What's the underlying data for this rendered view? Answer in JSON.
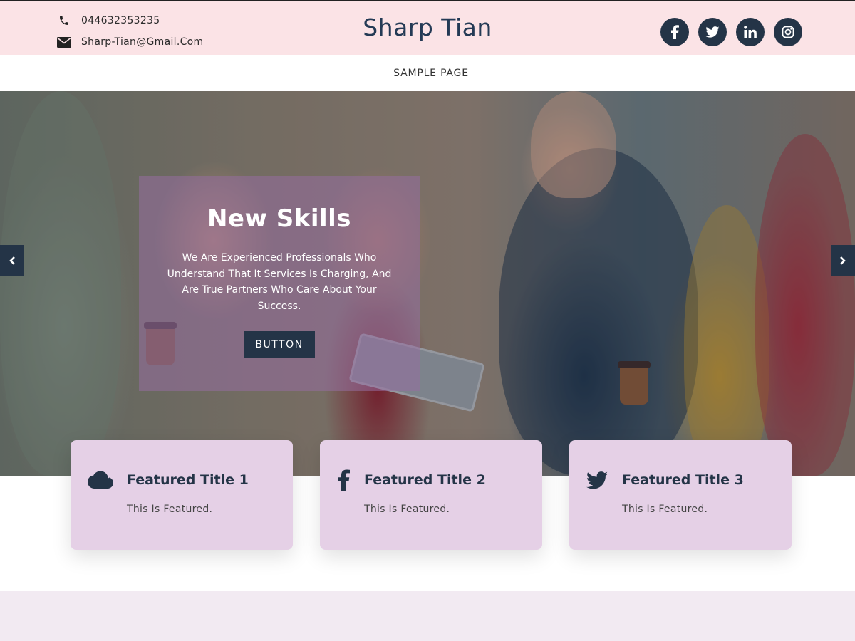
{
  "header": {
    "phone": "044632353235",
    "email": "Sharp-Tian@Gmail.Com",
    "site_title": "Sharp Tian",
    "social": [
      "facebook-icon",
      "twitter-icon",
      "linkedin-icon",
      "instagram-icon"
    ]
  },
  "nav": {
    "items": [
      {
        "label": "SAMPLE PAGE"
      }
    ]
  },
  "hero": {
    "title": "New Skills",
    "text": "We Are Experienced Professionals Who Understand That It Services Is Charging, And Are True Partners Who Care About Your Success.",
    "button_label": "BUTTON"
  },
  "features": [
    {
      "icon": "cloud-icon",
      "title": "Featured Title 1",
      "text": "This Is Featured."
    },
    {
      "icon": "facebook-icon",
      "title": "Featured Title 2",
      "text": "This Is Featured."
    },
    {
      "icon": "twitter-icon",
      "title": "Featured Title 3",
      "text": "This Is Featured."
    }
  ],
  "colors": {
    "topbar_bg": "#fbe3e6",
    "accent_dark": "#243447",
    "card_bg": "#e5d0e6",
    "caption_overlay": "#966ea0"
  }
}
